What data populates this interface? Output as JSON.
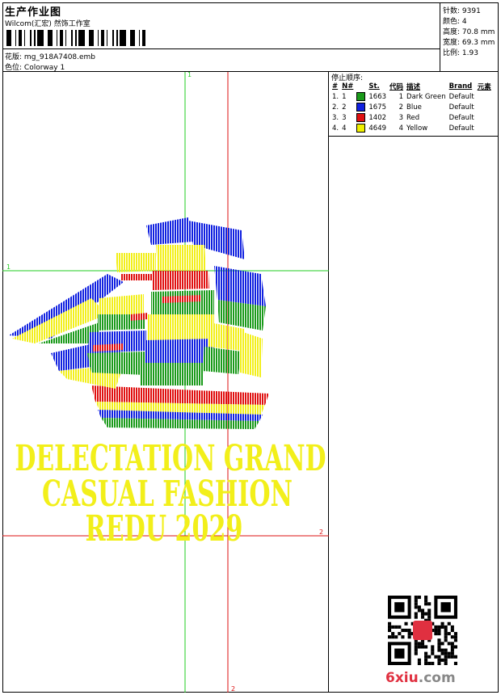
{
  "header": {
    "title": "生产作业图",
    "studio": "Wilcom(汇宏) 然饰工作室",
    "file_label": "花版:",
    "file_name": "mg_918A7408.emb",
    "colorway_label": "色位:",
    "colorway": "Colorway 1"
  },
  "stats": [
    {
      "label": "针数:",
      "value": "9391"
    },
    {
      "label": "颜色:",
      "value": "4"
    },
    {
      "label": "高度:",
      "value": "70.8 mm"
    },
    {
      "label": "宽度:",
      "value": "69.3 mm"
    },
    {
      "label": "比例:",
      "value": "1.93"
    }
  ],
  "stop_sequence": {
    "title": "停止顺序:",
    "headers": [
      "#",
      "N#",
      "St.",
      "代码",
      "描述",
      "Brand",
      "元素"
    ],
    "rows": [
      {
        "n": "1.",
        "nn": "1",
        "color": "#1a9a1a",
        "st": "1663",
        "code": "1",
        "desc": "Dark Green",
        "brand": "Default"
      },
      {
        "n": "2.",
        "nn": "2",
        "color": "#1020e0",
        "st": "1675",
        "code": "2",
        "desc": "Blue",
        "brand": "Default"
      },
      {
        "n": "3.",
        "nn": "3",
        "color": "#e01010",
        "st": "1402",
        "code": "3",
        "desc": "Red",
        "brand": "Default"
      },
      {
        "n": "4.",
        "nn": "4",
        "color": "#f0f000",
        "st": "4649",
        "code": "4",
        "desc": "Yellow",
        "brand": "Default"
      }
    ]
  },
  "design": {
    "text_lines": [
      "DELECTATION GRAND",
      "CASUAL FASHION",
      "REDU 2029"
    ],
    "text_color": "#f2ef1a"
  },
  "guides": {
    "green_label": "1",
    "red_label": "2",
    "green_color": "#22cc22",
    "red_color": "#dd1111"
  },
  "watermark": {
    "brand_main": "6xiu",
    "brand_tail": ".com"
  }
}
